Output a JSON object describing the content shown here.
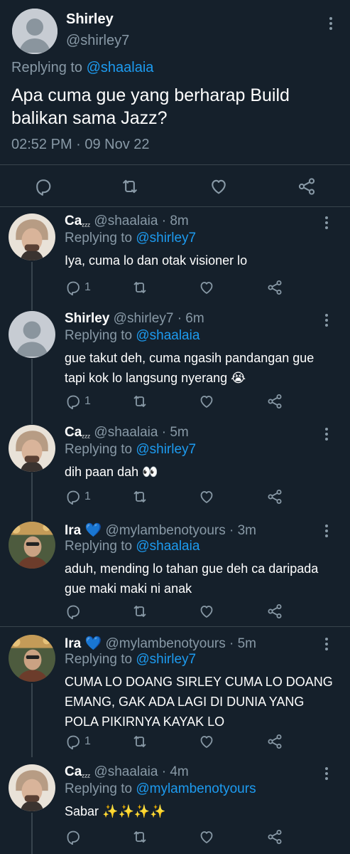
{
  "main_tweet": {
    "name": "Shirley",
    "handle": "@shirley7",
    "replying_prefix": "Replying to ",
    "replying_to": "@shaalaia",
    "text": "Apa cuma gue yang berharap Build balikan sama Jazz?",
    "timestamp": "02:52 PM · 09 Nov 22",
    "avatar_icon": "default-avatar-icon"
  },
  "replies": [
    {
      "name": "Ca",
      "name_decoration": "ᶻᶻᶻ",
      "handle": "@shaalaia · 8m",
      "replying_prefix": "Replying to ",
      "replying_to": "@shirley7",
      "text": "Iya, cuma lo dan otak visioner lo",
      "reply_count": "1",
      "retweet_count": "",
      "avatar_icon": "photo-avatar-icon"
    },
    {
      "name": "Shirley",
      "name_decoration": "",
      "handle": "@shirley7 · 6m",
      "replying_prefix": "Replying to ",
      "replying_to": "@shaalaia",
      "text": "gue takut deh, cuma ngasih pandangan gue tapi kok lo langsung nyerang 😭",
      "reply_count": "1",
      "retweet_count": "",
      "avatar_icon": "default-avatar-icon"
    },
    {
      "name": "Ca",
      "name_decoration": "ᶻᶻᶻ",
      "handle": "@shaalaia · 5m",
      "replying_prefix": "Replying to ",
      "replying_to": "@shirley7",
      "text": "dih paan dah 👀",
      "reply_count": "1",
      "retweet_count": "",
      "avatar_icon": "photo-avatar-icon"
    },
    {
      "name": "Ira",
      "name_decoration": "💙",
      "handle": "@mylambenotyours · 3m",
      "replying_prefix": "Replying to ",
      "replying_to": "@shaalaia",
      "text": "aduh, mending lo tahan gue deh ca daripada gue maki maki ni anak",
      "reply_count": "",
      "retweet_count": "",
      "avatar_icon": "photo-avatar-icon"
    },
    {
      "name": "Ira",
      "name_decoration": "💙",
      "handle": "@mylambenotyours · 5m",
      "replying_prefix": "Replying to ",
      "replying_to": "@shirley7",
      "text": "CUMA LO DOANG SIRLEY CUMA LO DOANG EMANG, GAK ADA LAGI DI DUNIA YANG POLA PIKIRNYA KAYAK LO",
      "reply_count": "1",
      "retweet_count": "",
      "avatar_icon": "photo-avatar-icon"
    },
    {
      "name": "Ca",
      "name_decoration": "ᶻᶻᶻ",
      "handle": "@shaalaia · 4m",
      "replying_prefix": "Replying to ",
      "replying_to": "@mylambenotyours",
      "text": "Sabar ✨✨✨✨",
      "reply_count": "",
      "retweet_count": "",
      "avatar_icon": "photo-avatar-icon"
    }
  ],
  "colors": {
    "background": "#15202b",
    "link": "#1d9bf0",
    "muted": "#8899a6",
    "divider": "#38444d"
  }
}
